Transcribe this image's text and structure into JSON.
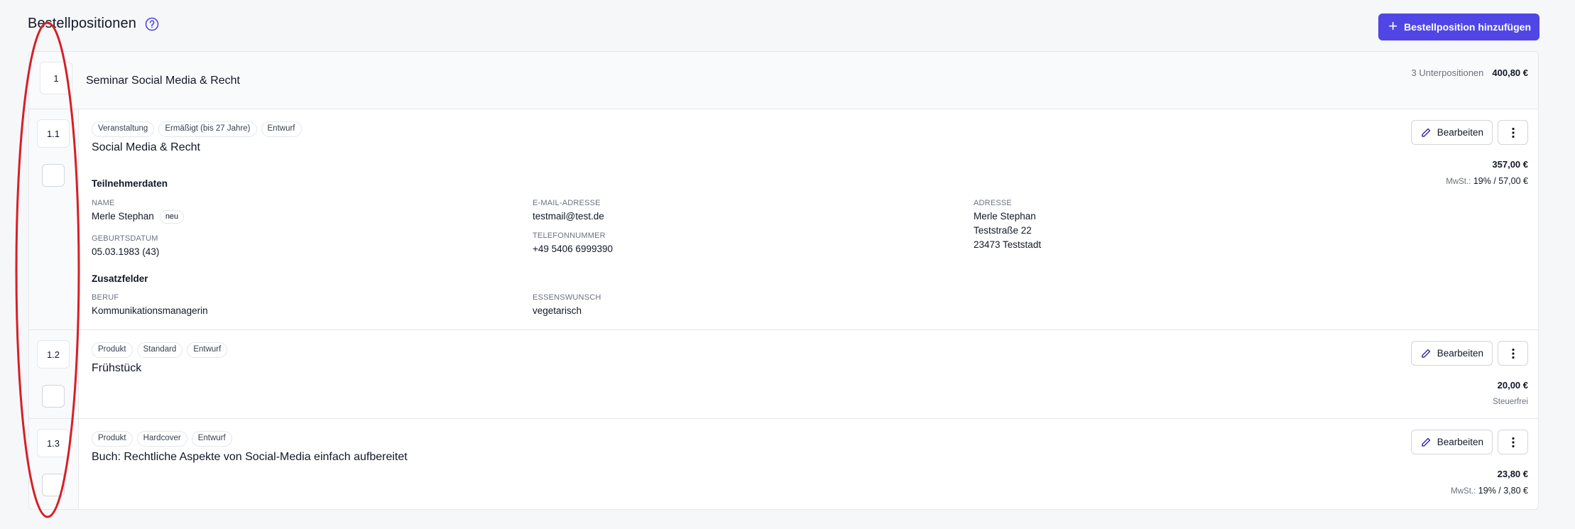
{
  "header": {
    "title": "Bestellpositionen",
    "add_button_label": "Bestellposition hinzufügen"
  },
  "main_position": {
    "number": "1",
    "title": "Seminar Social Media & Recht",
    "subpositions_text": "3 Unterpositionen",
    "total": "400,80 €"
  },
  "items": [
    {
      "number": "1.1",
      "tags": [
        "Veranstaltung",
        "Ermäßigt (bis 27 Jahre)",
        "Entwurf"
      ],
      "title": "Social Media & Recht",
      "edit_label": "Bearbeiten",
      "price": "357,00 €",
      "tax_label": "MwSt.:",
      "tax_value": "19% / 57,00 €",
      "participant": {
        "heading": "Teilnehmerdaten",
        "name_label": "NAME",
        "name_value": "Merle Stephan",
        "name_badge": "neu",
        "birth_label": "GEBURTSDATUM",
        "birth_value": "05.03.1983 (43)",
        "email_label": "E-MAIL-ADRESSE",
        "email_value": "testmail@test.de",
        "phone_label": "TELEFONNUMMER",
        "phone_value": "+49 5406 6999390",
        "address_label": "ADRESSE",
        "address_line1": "Merle Stephan",
        "address_line2": "Teststraße 22",
        "address_line3": "23473 Teststadt"
      },
      "extra": {
        "heading": "Zusatzfelder",
        "job_label": "BERUF",
        "job_value": "Kommunikationsmanagerin",
        "meal_label": "ESSENSWUNSCH",
        "meal_value": "vegetarisch"
      }
    },
    {
      "number": "1.2",
      "tags": [
        "Produkt",
        "Standard",
        "Entwurf"
      ],
      "title": "Frühstück",
      "edit_label": "Bearbeiten",
      "price": "20,00 €",
      "tax_note": "Steuerfrei"
    },
    {
      "number": "1.3",
      "tags": [
        "Produkt",
        "Hardcover",
        "Entwurf"
      ],
      "title": "Buch: Rechtliche Aspekte von Social-Media einfach aufbereitet",
      "edit_label": "Bearbeiten",
      "price": "23,80 €",
      "tax_label": "MwSt.:",
      "tax_value": "19% / 3,80 €"
    }
  ],
  "colors": {
    "accent": "#4f46e5",
    "annotation": "#d61f26"
  }
}
